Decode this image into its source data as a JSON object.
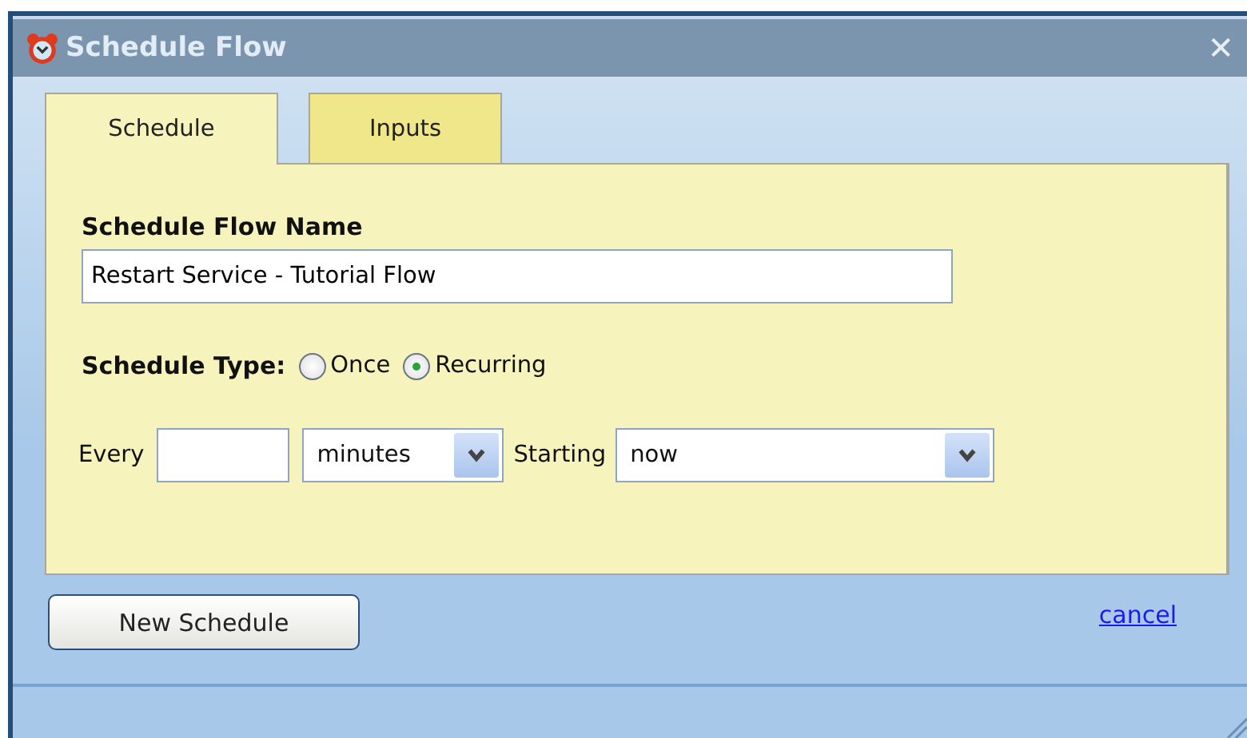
{
  "window": {
    "title": "Schedule Flow",
    "close": "✕"
  },
  "tabs": [
    {
      "label": "Schedule",
      "selected": true
    },
    {
      "label": "Inputs",
      "selected": false
    }
  ],
  "name_field": {
    "label": "Schedule Flow Name",
    "value": "Restart Service - Tutorial Flow"
  },
  "schedule_type": {
    "label": "Schedule Type:",
    "options": [
      {
        "label": "Once",
        "selected": false
      },
      {
        "label": "Recurring",
        "selected": true
      }
    ]
  },
  "recurrence": {
    "every_label": "Every",
    "unit": "minutes",
    "starting_label": "Starting",
    "start": "now"
  },
  "buttons": {
    "new_schedule": "New Schedule",
    "cancel": "cancel"
  }
}
